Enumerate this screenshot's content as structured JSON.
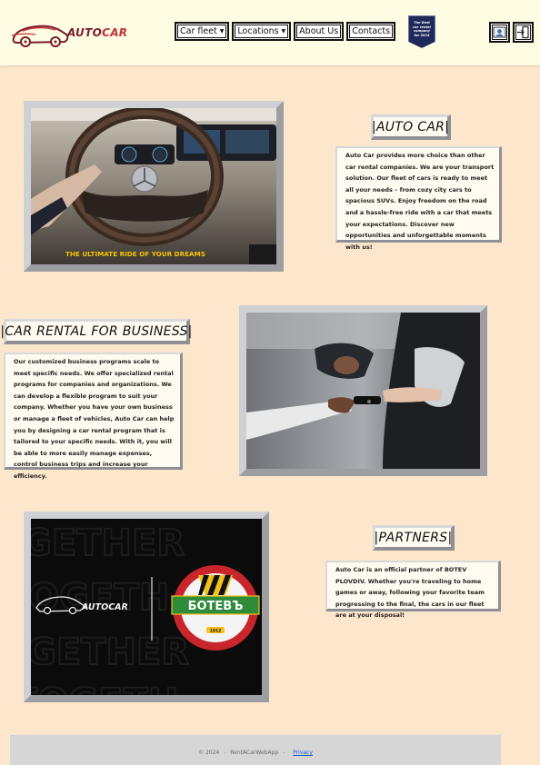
{
  "header": {
    "logo": {
      "auto": "AUTO",
      "car": "CAR"
    },
    "nav": [
      {
        "label": "Car fleet",
        "dropdown": true
      },
      {
        "label": "Locations",
        "dropdown": true
      },
      {
        "label": "About Us",
        "dropdown": false
      },
      {
        "label": "Contacts",
        "dropdown": false
      }
    ],
    "badge": {
      "line1": "The Best",
      "line2": "car rental",
      "line3": "company",
      "line4": "for 2024"
    },
    "icons": {
      "profile": "user-card-icon",
      "login": "login-icon"
    }
  },
  "sections": {
    "intro": {
      "image_caption": "THE ULTIMATE RIDE OF YOUR DREAMS",
      "title": "|AUTO CAR|",
      "text": "Auto Car provides more choice than other car rental companies. We are your transport solution. Our fleet of cars is ready to meet all your needs – from cozy city cars to spacious SUVs. Enjoy freedom on the road and a hassle-free ride with a car that meets your expectations. Discover new opportunities and unforgettable moments with us!"
    },
    "business": {
      "title": "|CAR RENTAL FOR BUSINESS|",
      "text": "Our customized business programs scale to meet specific needs. We offer specialized rental programs for companies and organizations. We can develop a flexible program to suit your company. Whether you have your own business or manage a fleet of vehicles, Auto Car can help you by designing a car rental program that is tailored to your specific needs. With it, you will be able to more easily manage expenses, control business trips and increase your efficiency."
    },
    "partners": {
      "image_left": "AUTOCAR",
      "image_right": "БОТЕВЪ",
      "image_year": "1912",
      "title": "|PARTNERS|",
      "text": "Auto Car is an official partner of BOTEV PLOVDIV. Whether you're traveling to home games or away, following your favorite team progressing to the final, the cars in our fleet are at your disposal!"
    }
  },
  "footer": {
    "copyright": "© 2024",
    "app": "RentACarWebApp",
    "sep": "-",
    "privacy": "Privacy"
  },
  "colors": {
    "page_bg": "#fde7cc",
    "header_bg": "#fefde3",
    "footer_bg": "#d6d6d6",
    "brand_dark": "#7a1b2c",
    "brand_red": "#c4303a"
  }
}
